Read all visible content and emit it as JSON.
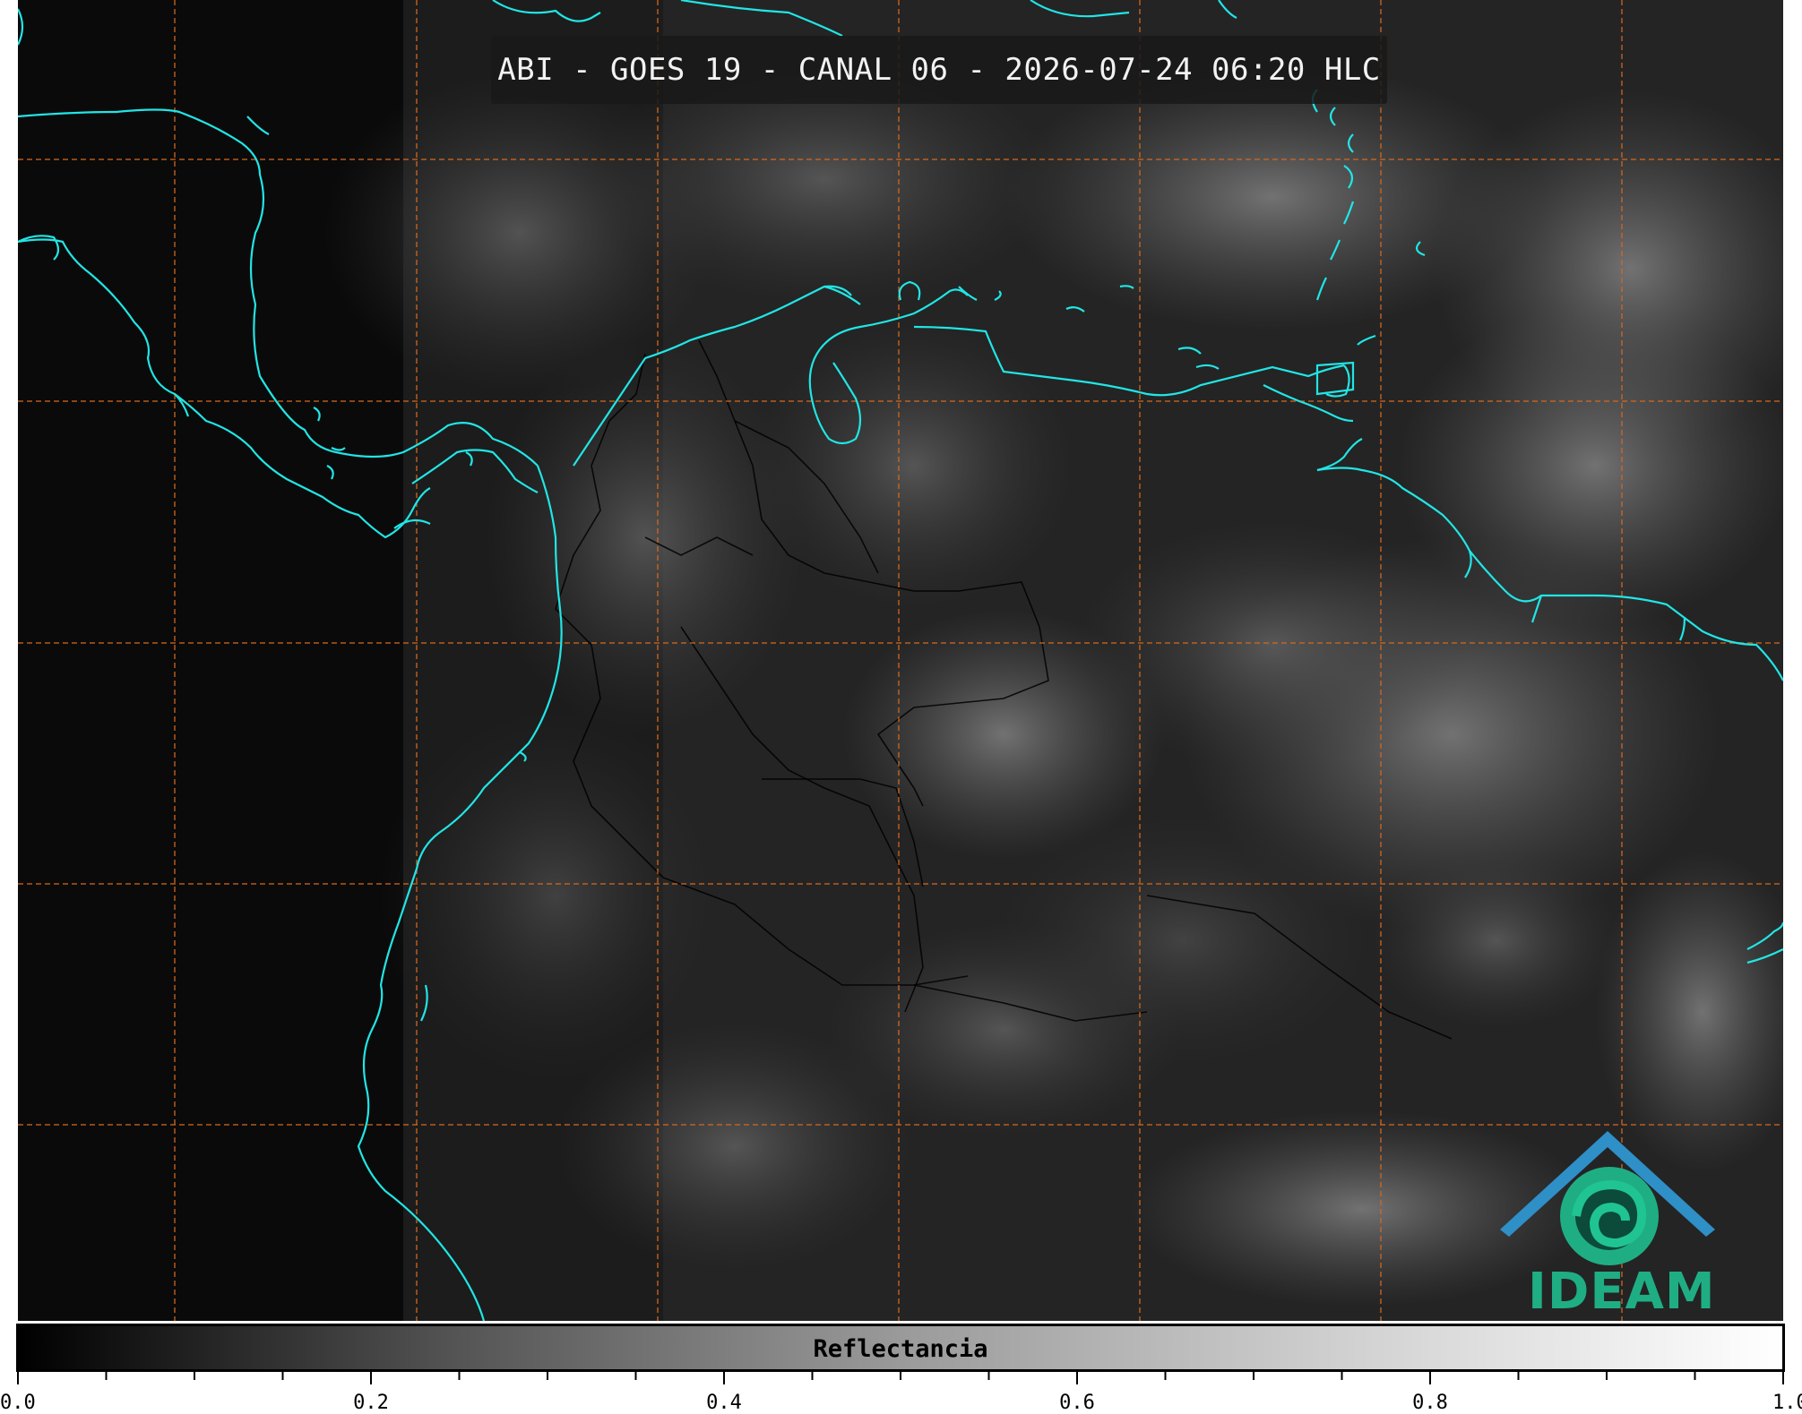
{
  "title": "ABI - GOES 19 - CANAL 06 - 2026-07-24 06:20 HLC",
  "colorbar": {
    "label": "Reflectancia",
    "tick_labels": [
      "0.0",
      "0.2",
      "0.4",
      "0.6",
      "0.8",
      "1.0"
    ],
    "range": [
      0.0,
      1.0
    ]
  },
  "logo": {
    "text": "IDEAM"
  },
  "colors": {
    "coastline": "#22e5e5",
    "grid": "#d2691e",
    "borders": "#000000",
    "logo": "#1fae83"
  },
  "icons": [
    "ideam-logo-icon"
  ]
}
